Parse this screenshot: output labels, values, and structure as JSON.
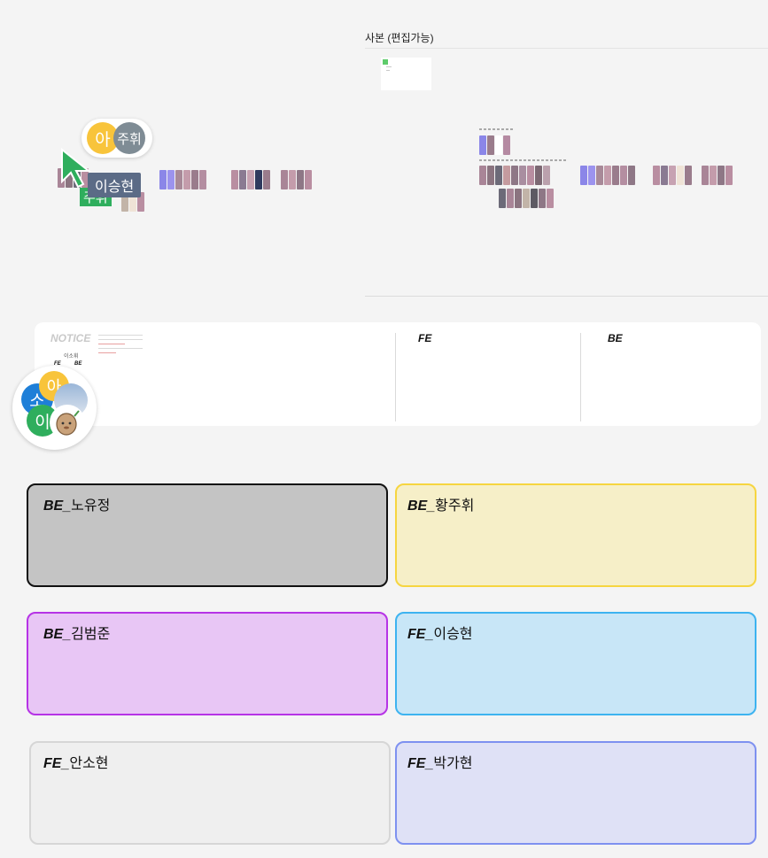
{
  "copy_frame": {
    "label": "사본 (편집가능)"
  },
  "cursors": {
    "presence_avatars": [
      "아",
      "주휘"
    ],
    "cursor_label": "이승현",
    "green_tag": "주휘"
  },
  "notice_board": {
    "title": "NOTICE",
    "fe_heading": "FE",
    "be_heading": "BE",
    "mini_name": "이소휘",
    "mini_fe": "FE",
    "mini_be": "BE"
  },
  "group_avatars": [
    "아",
    "소",
    "이"
  ],
  "cards": [
    {
      "prefix": "BE_",
      "name": "노유정",
      "bg": "#c4c4c4",
      "border": "#111111"
    },
    {
      "prefix": "BE_",
      "name": "황주휘",
      "bg": "#f6efc8",
      "border": "#f6d540"
    },
    {
      "prefix": "BE_",
      "name": "김범준",
      "bg": "#e8c6f5",
      "border": "#b633e6"
    },
    {
      "prefix": "FE_",
      "name": "이승현",
      "bg": "#c8e6f7",
      "border": "#3db3f0"
    },
    {
      "prefix": "FE_",
      "name": "안소현",
      "bg": "#efefef",
      "border": "#d6d6d6"
    },
    {
      "prefix": "FE_",
      "name": "박가현",
      "bg": "#dfe1f6",
      "border": "#7e91f0"
    }
  ],
  "colors": {
    "avatar_yellow": "#f8c43b",
    "avatar_gray": "#7f8c95",
    "avatar_blue": "#1e7fd8",
    "avatar_green": "#2fae5d",
    "cursor_tag": "#5b6b86"
  }
}
